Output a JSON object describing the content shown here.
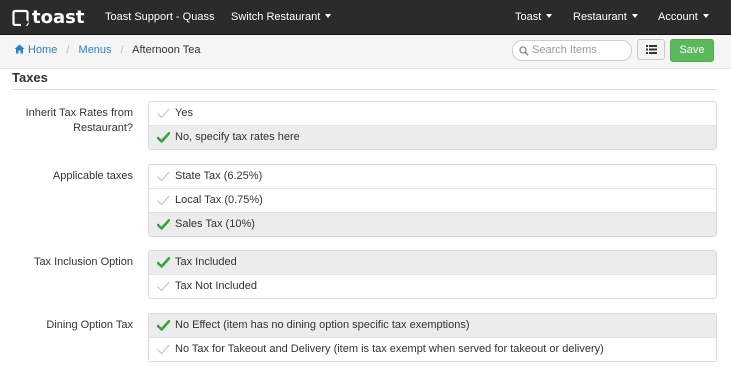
{
  "navbar": {
    "logo_text": "toast",
    "support_label": "Toast Support - Quass",
    "switch_restaurant_label": "Switch Restaurant",
    "toast_menu_label": "Toast",
    "restaurant_menu_label": "Restaurant",
    "account_menu_label": "Account"
  },
  "breadcrumb": {
    "home": "Home",
    "menus": "Menus",
    "current": "Afternoon Tea"
  },
  "toolbar": {
    "search_placeholder": "Search Items",
    "list_icon": "list-icon",
    "save_label": "Save"
  },
  "section": {
    "title": "Taxes"
  },
  "fields": {
    "inherit": {
      "label": "Inherit Tax Rates from Restaurant?",
      "options": [
        {
          "label": "Yes",
          "selected": false
        },
        {
          "label": "No, specify tax rates here",
          "selected": true
        }
      ]
    },
    "applicable": {
      "label": "Applicable taxes",
      "options": [
        {
          "label": "State Tax (6.25%)",
          "selected": false
        },
        {
          "label": "Local Tax (0.75%)",
          "selected": false
        },
        {
          "label": "Sales Tax (10%)",
          "selected": true
        }
      ]
    },
    "inclusion": {
      "label": "Tax Inclusion Option",
      "options": [
        {
          "label": "Tax Included",
          "selected": true
        },
        {
          "label": "Tax Not Included",
          "selected": false
        }
      ]
    },
    "dining": {
      "label": "Dining Option Tax",
      "options": [
        {
          "label": "No Effect (item has no dining option specific tax exemptions)",
          "selected": true
        },
        {
          "label": "No Tax for Takeout and Delivery (item is tax exempt when served for takeout or delivery)",
          "selected": false
        }
      ]
    }
  },
  "colors": {
    "navbar": "#2b2b2b",
    "link": "#2f80c2",
    "check_selected": "#3aa43a",
    "check_unselected": "#c9c9c9",
    "save_button": "#5cb85c",
    "selected_row": "#ececec"
  },
  "icons": {
    "home": "home-icon",
    "search": "search-icon",
    "check": "check-icon",
    "caret": "caret-down-icon"
  }
}
